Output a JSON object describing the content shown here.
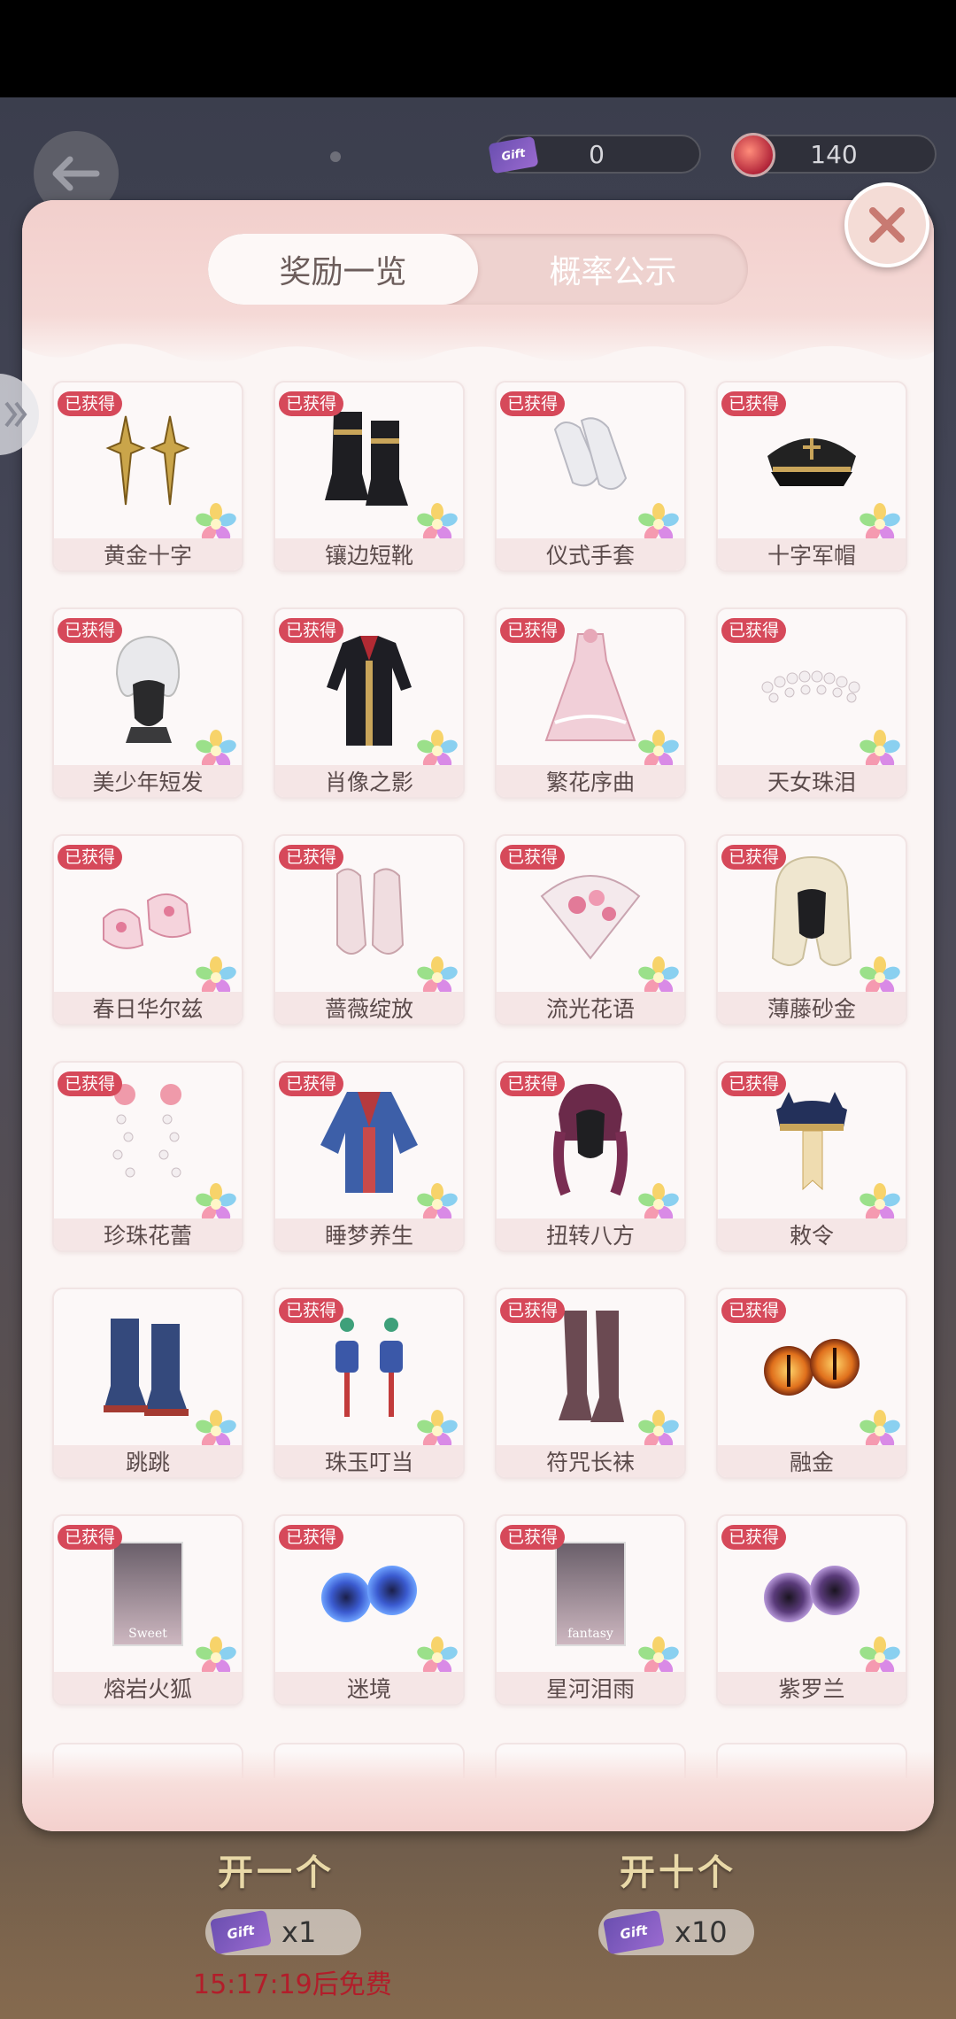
{
  "header": {
    "ticket_count": "0",
    "ticket_icon_text": "Gift",
    "gem_count": "140"
  },
  "tabs": [
    {
      "label": "奖励一览",
      "active": true
    },
    {
      "label": "概率公示",
      "active": false
    }
  ],
  "badge_text": "已获得",
  "items": [
    {
      "name": "黄金十字",
      "obtained": true,
      "icon": "gold-cross-earrings-icon"
    },
    {
      "name": "镶边短靴",
      "obtained": true,
      "icon": "trimmed-boots-icon"
    },
    {
      "name": "仪式手套",
      "obtained": true,
      "icon": "ceremonial-gloves-icon"
    },
    {
      "name": "十字军帽",
      "obtained": true,
      "icon": "military-cap-icon"
    },
    {
      "name": "美少年短发",
      "obtained": true,
      "icon": "short-hair-icon"
    },
    {
      "name": "肖像之影",
      "obtained": true,
      "icon": "coat-outfit-icon"
    },
    {
      "name": "繁花序曲",
      "obtained": true,
      "icon": "floral-dress-icon"
    },
    {
      "name": "天女珠泪",
      "obtained": true,
      "icon": "pearl-headband-icon"
    },
    {
      "name": "春日华尔兹",
      "obtained": true,
      "icon": "pink-shoes-icon"
    },
    {
      "name": "蔷薇绽放",
      "obtained": true,
      "icon": "lace-gloves-icon"
    },
    {
      "name": "流光花语",
      "obtained": true,
      "icon": "flower-fan-icon"
    },
    {
      "name": "薄藤砂金",
      "obtained": true,
      "icon": "long-hair-icon"
    },
    {
      "name": "珍珠花蕾",
      "obtained": true,
      "icon": "pearl-earrings-icon"
    },
    {
      "name": "睡梦养生",
      "obtained": true,
      "icon": "robe-outfit-icon"
    },
    {
      "name": "扭转八方",
      "obtained": true,
      "icon": "braided-hair-icon"
    },
    {
      "name": "敕令",
      "obtained": true,
      "icon": "talisman-hat-icon"
    },
    {
      "name": "跳跳",
      "obtained": false,
      "icon": "blue-boots-icon"
    },
    {
      "name": "珠玉叮当",
      "obtained": true,
      "icon": "lantern-earrings-icon"
    },
    {
      "name": "符咒长袜",
      "obtained": true,
      "icon": "stockings-icon"
    },
    {
      "name": "融金",
      "obtained": true,
      "icon": "golden-eyes-icon"
    },
    {
      "name": "熔岩火狐",
      "obtained": true,
      "icon": "makeup-card-icon",
      "card_text": "Sweet"
    },
    {
      "name": "迷境",
      "obtained": true,
      "icon": "galaxy-eyes-icon"
    },
    {
      "name": "星河泪雨",
      "obtained": true,
      "icon": "makeup-card-icon",
      "card_text": "fantasy"
    },
    {
      "name": "紫罗兰",
      "obtained": true,
      "icon": "violet-eyes-icon"
    }
  ],
  "bottom": {
    "draw_one_label": "开一个",
    "draw_ten_label": "开十个",
    "cost_one": "x1",
    "cost_ten": "x10",
    "free_timer": "15:17:19后免费"
  }
}
